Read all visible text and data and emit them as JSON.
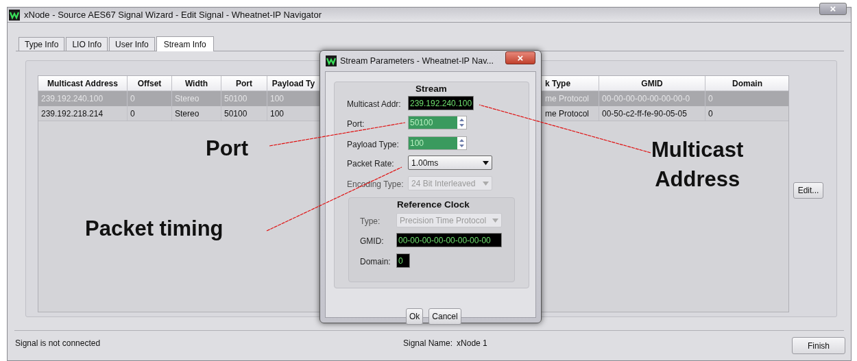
{
  "window": {
    "title": "xNode - Source AES67 Signal Wizard - Edit Signal - Wheatnet-IP Navigator",
    "close": "×"
  },
  "tabs": [
    {
      "label": "Type Info",
      "selected": false
    },
    {
      "label": "LIO Info",
      "selected": false
    },
    {
      "label": "User Info",
      "selected": false
    },
    {
      "label": "Stream Info",
      "selected": true
    }
  ],
  "table": {
    "columns": [
      "Multicast Address",
      "Offset",
      "Width",
      "Port",
      "Payload Ty",
      "k Type",
      "GMID",
      "Domain"
    ],
    "rows": [
      {
        "selected": true,
        "cells": [
          "239.192.240.100",
          "0",
          "Stereo",
          "50100",
          "100",
          "me Protocol",
          "00-00-00-00-00-00-00-0",
          "0"
        ]
      },
      {
        "selected": false,
        "cells": [
          "239.192.218.214",
          "0",
          "Stereo",
          "50100",
          "100",
          "me Protocol",
          "00-50-c2-ff-fe-90-05-05",
          "0"
        ]
      }
    ]
  },
  "edit_button": "Edit...",
  "status_bar": {
    "message": "Signal is not connected",
    "signal_name_label": "Signal Name:",
    "signal_name": "xNode 1",
    "finish_button": "Finish"
  },
  "dialog": {
    "title": "Stream Parameters - Wheatnet-IP Nav...",
    "close": "×",
    "stream_group": "Stream",
    "fields": [
      {
        "kind": "text",
        "label": "Multicast Addr:",
        "value": "239.192.240.100",
        "disabled": false
      },
      {
        "kind": "spin",
        "label": "Port:",
        "value": "50100",
        "disabled": false
      },
      {
        "kind": "spin",
        "label": "Payload Type:",
        "value": "100",
        "disabled": false
      },
      {
        "kind": "dropdown",
        "label": "Packet Rate:",
        "value": "1.00ms",
        "disabled": false
      },
      {
        "kind": "dropdown",
        "label": "Encoding Type:",
        "value": "24 Bit Interleaved",
        "disabled": true
      }
    ],
    "clock_group": "Reference Clock",
    "clock_fields": [
      {
        "kind": "dropdown",
        "label": "Type:",
        "value": "Precision Time Protocol",
        "disabled": true
      },
      {
        "kind": "text",
        "label": "GMID:",
        "value": "00-00-00-00-00-00-00-00",
        "disabled": false
      },
      {
        "kind": "short",
        "label": "Domain:",
        "value": "0",
        "disabled": false
      }
    ],
    "buttons": [
      "Ok",
      "Cancel"
    ]
  },
  "annotations": [
    "Port",
    "Multicast\nAddress",
    "Packet timing"
  ]
}
